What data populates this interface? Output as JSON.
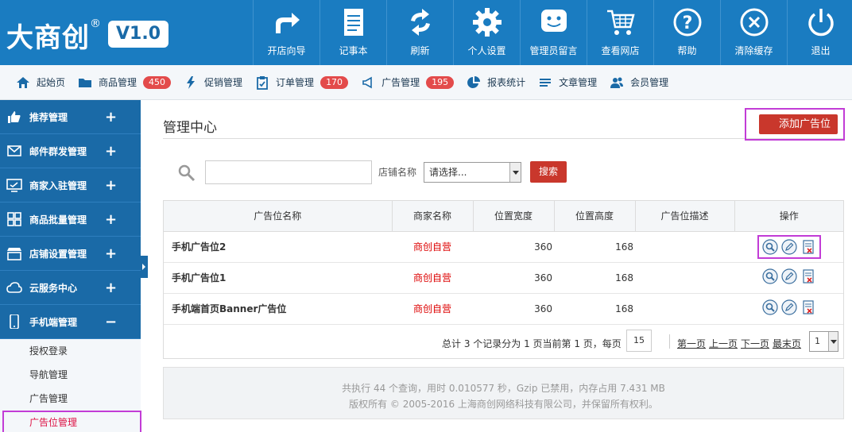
{
  "logo": {
    "text": "大商创",
    "reg": "®",
    "version": "V1.0"
  },
  "topnav": [
    {
      "label": "开店向导",
      "icon": "arrow-share-icon"
    },
    {
      "label": "记事本",
      "icon": "notepad-icon"
    },
    {
      "label": "刷新",
      "icon": "refresh-icon"
    },
    {
      "label": "个人设置",
      "icon": "gear-icon"
    },
    {
      "label": "管理员留言",
      "icon": "chat-face-icon"
    },
    {
      "label": "查看网店",
      "icon": "cart-icon"
    },
    {
      "label": "帮助",
      "icon": "help-icon"
    },
    {
      "label": "清除缓存",
      "icon": "close-circle-icon"
    },
    {
      "label": "退出",
      "icon": "power-icon"
    }
  ],
  "subnav": [
    {
      "label": "起始页",
      "icon": "home-icon",
      "badge": ""
    },
    {
      "label": "商品管理",
      "icon": "folder-icon",
      "badge": "450"
    },
    {
      "label": "促销管理",
      "icon": "lightning-icon",
      "badge": ""
    },
    {
      "label": "订单管理",
      "icon": "clipboard-icon",
      "badge": "170"
    },
    {
      "label": "广告管理",
      "icon": "megaphone-icon",
      "badge": "195"
    },
    {
      "label": "报表统计",
      "icon": "pie-chart-icon",
      "badge": ""
    },
    {
      "label": "文章管理",
      "icon": "list-icon",
      "badge": ""
    },
    {
      "label": "会员管理",
      "icon": "users-icon",
      "badge": ""
    }
  ],
  "sidebar": {
    "groups": [
      {
        "label": "推荐管理",
        "icon": "thumbs-up-icon",
        "toggle": "+"
      },
      {
        "label": "邮件群发管理",
        "icon": "envelope-icon",
        "toggle": "+"
      },
      {
        "label": "商家入驻管理",
        "icon": "monitor-icon",
        "toggle": "+"
      },
      {
        "label": "商品批量管理",
        "icon": "grid-icon",
        "toggle": "+"
      },
      {
        "label": "店铺设置管理",
        "icon": "store-icon",
        "toggle": "+"
      },
      {
        "label": "云服务中心",
        "icon": "cloud-icon",
        "toggle": "+"
      },
      {
        "label": "手机端管理",
        "icon": "mobile-icon",
        "toggle": "−"
      }
    ],
    "subitems": [
      {
        "label": "授权登录"
      },
      {
        "label": "导航管理"
      },
      {
        "label": "广告管理"
      },
      {
        "label": "广告位管理"
      }
    ]
  },
  "main": {
    "title": "管理中心",
    "add_button": "添加广告位",
    "search": {
      "input_value": "",
      "shop_label": "店铺名称",
      "shop_select": "请选择...",
      "button": "搜索"
    },
    "table": {
      "headers": [
        "广告位名称",
        "商家名称",
        "位置宽度",
        "位置高度",
        "广告位描述",
        "操作"
      ],
      "rows": [
        {
          "name": "手机广告位2",
          "merchant": "商创自营",
          "width": "360",
          "height": "168",
          "desc": ""
        },
        {
          "name": "手机广告位1",
          "merchant": "商创自营",
          "width": "360",
          "height": "168",
          "desc": ""
        },
        {
          "name": "手机端首页Banner广告位",
          "merchant": "商创自营",
          "width": "360",
          "height": "168",
          "desc": ""
        }
      ]
    },
    "pager": {
      "summary": "总计 3 个记录分为 1 页当前第 1 页，每页",
      "page_size": "15",
      "first": "第一页",
      "prev": "上一页",
      "next": "下一页",
      "last": "最末页",
      "current": "1"
    },
    "footer": {
      "line1": "共执行 44 个查询，用时 0.010577 秒，Gzip 已禁用，内存占用 7.431 MB",
      "line2": "版权所有 © 2005-2016 上海商创网络科技有限公司，并保留所有权利。"
    }
  },
  "colors": {
    "header_blue": "#1a7cc1",
    "sidebar_blue": "#1a6aa7",
    "button_red": "#c9372c",
    "highlight_purple": "#c23cd6",
    "merchant_red": "#dd0000"
  }
}
